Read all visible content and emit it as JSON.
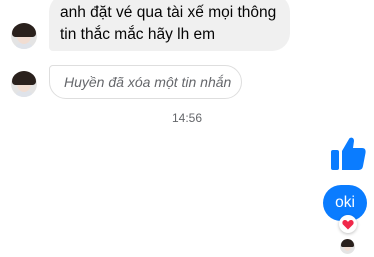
{
  "colors": {
    "outgoing_bubble": "#0a7cff",
    "incoming_bubble": "#f0f0f0",
    "like_icon": "#0a7cff",
    "reaction_heart": "#f0284a",
    "muted_text": "#65676b"
  },
  "messages": {
    "incoming_first": {
      "line1": "anh đặt vé qua tài xế mọi thông",
      "line2": "tin thắc mắc hãy lh em"
    },
    "deleted_notice": "Huyền đã xóa một tin nhắn",
    "timestamp": "14:56",
    "outgoing_like_icon": "thumbs-up-icon",
    "outgoing_text": "oki",
    "reaction_icon": "heart-icon"
  }
}
